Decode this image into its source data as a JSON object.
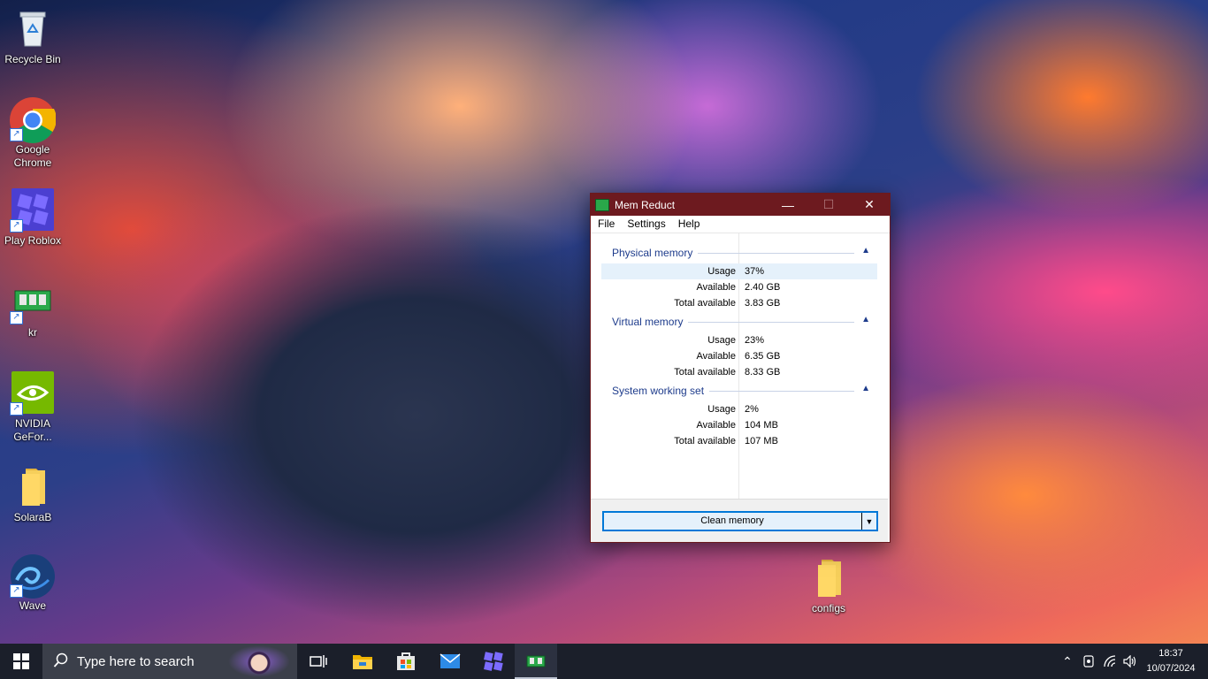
{
  "desktop": {
    "icons": [
      {
        "label": "Recycle Bin"
      },
      {
        "label": "Google Chrome"
      },
      {
        "label": "Play Roblox"
      },
      {
        "label": "kr"
      },
      {
        "label": "NVIDIA GeFor..."
      },
      {
        "label": "SolaraB"
      },
      {
        "label": "Wave"
      },
      {
        "label": "configs"
      }
    ]
  },
  "window": {
    "title": "Mem Reduct",
    "menu": [
      "File",
      "Settings",
      "Help"
    ],
    "groups": [
      {
        "name": "Physical memory",
        "rows": [
          {
            "key": "Usage",
            "value": "37%"
          },
          {
            "key": "Available",
            "value": "2.40 GB"
          },
          {
            "key": "Total available",
            "value": "3.83 GB"
          }
        ]
      },
      {
        "name": "Virtual memory",
        "rows": [
          {
            "key": "Usage",
            "value": "23%"
          },
          {
            "key": "Available",
            "value": "6.35 GB"
          },
          {
            "key": "Total available",
            "value": "8.33 GB"
          }
        ]
      },
      {
        "name": "System working set",
        "rows": [
          {
            "key": "Usage",
            "value": "2%"
          },
          {
            "key": "Available",
            "value": "104 MB"
          },
          {
            "key": "Total available",
            "value": "107 MB"
          }
        ]
      }
    ],
    "clean_button": "Clean memory"
  },
  "taskbar": {
    "search_placeholder": "Type here to search",
    "time": "18:37",
    "date": "10/07/2024"
  },
  "colors": {
    "titlebar": "#6d1a1f",
    "taskbar": "#1b1f2a",
    "accent": "#0078d7",
    "group_header": "#1e3c8c"
  }
}
